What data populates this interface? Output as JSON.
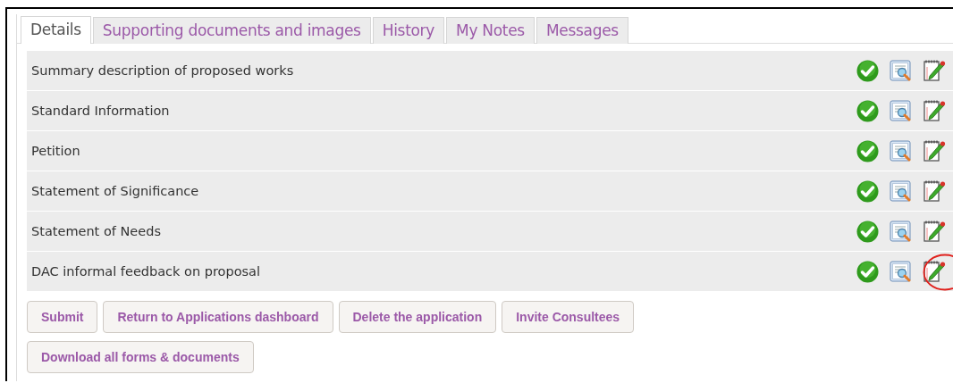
{
  "tabs": [
    {
      "label": "Details",
      "selected": true
    },
    {
      "label": "Supporting documents and images",
      "selected": false
    },
    {
      "label": "History",
      "selected": false
    },
    {
      "label": "My Notes",
      "selected": false
    },
    {
      "label": "Messages",
      "selected": false
    }
  ],
  "sections": [
    {
      "title": "Summary description of proposed works",
      "complete": true,
      "circled": false
    },
    {
      "title": "Standard Information",
      "complete": true,
      "circled": false
    },
    {
      "title": "Petition",
      "complete": true,
      "circled": false
    },
    {
      "title": "Statement of Significance",
      "complete": true,
      "circled": false
    },
    {
      "title": "Statement of Needs",
      "complete": true,
      "circled": false
    },
    {
      "title": "DAC informal feedback on proposal",
      "complete": true,
      "circled": true
    }
  ],
  "buttons": [
    [
      "Submit",
      "Return to Applications dashboard",
      "Delete the application",
      "Invite Consultees"
    ],
    [
      "Download all forms & documents"
    ]
  ]
}
